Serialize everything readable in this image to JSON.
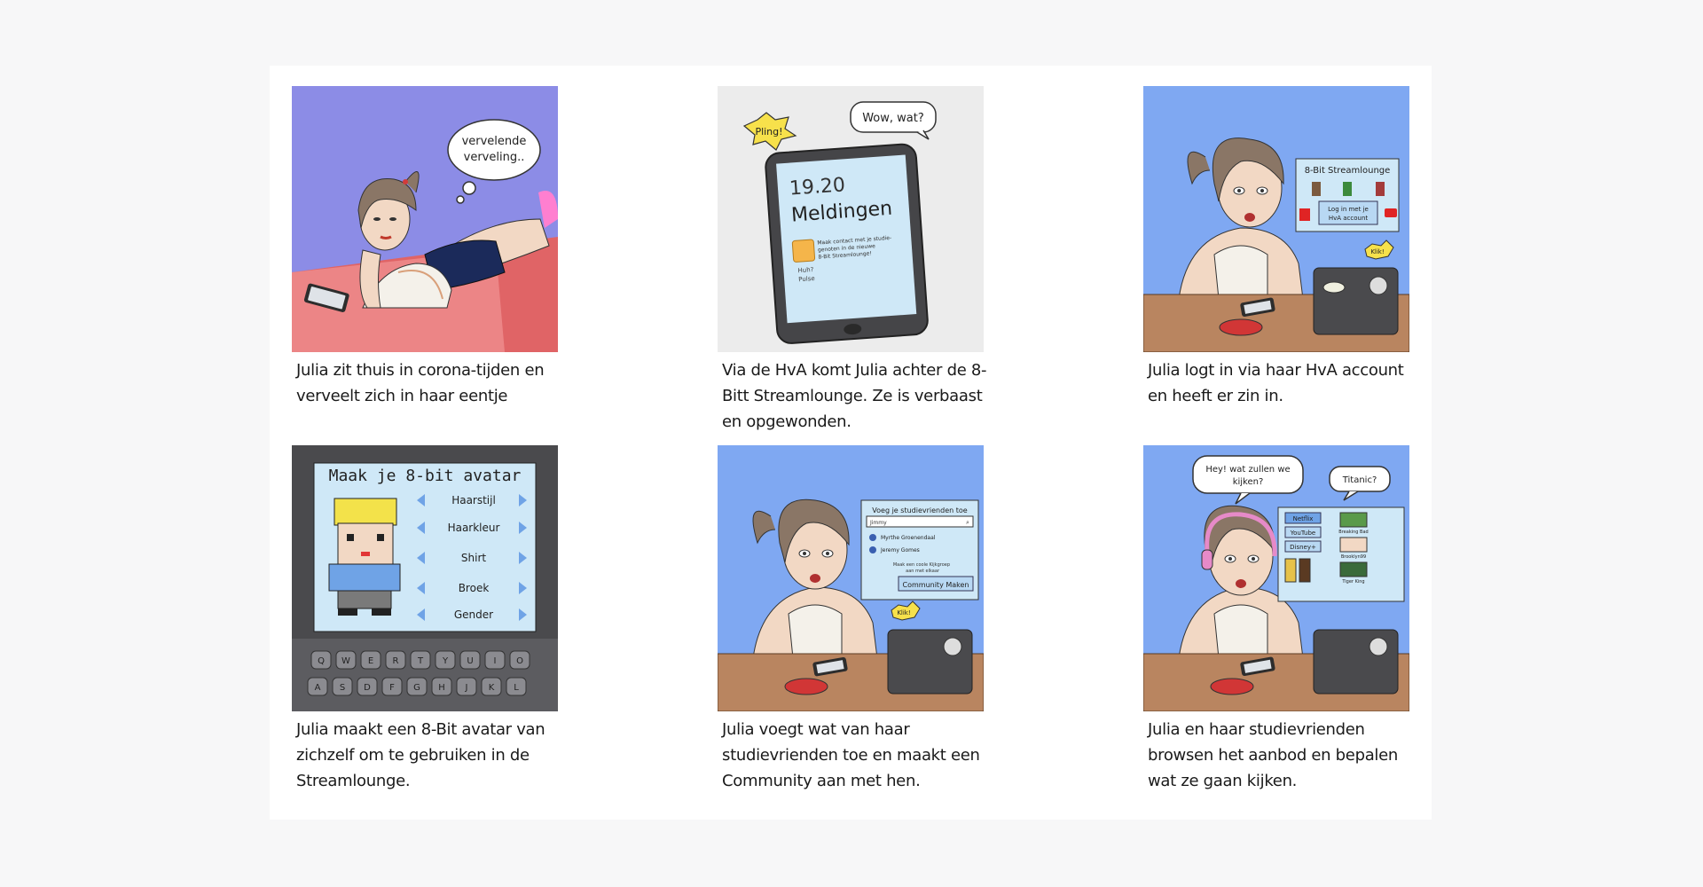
{
  "panels": [
    {
      "caption": "Julia zit thuis in corona-tijden en verveelt zich in haar eentje",
      "bubble": [
        "vervelende",
        "verveling.."
      ]
    },
    {
      "caption": "Via de HvA komt Julia achter de 8-Bitt Streamlounge. Ze is verbaast en opgewonden.",
      "burst": "Pling!",
      "bubble": "Wow, wat?",
      "phone_time": "19.20",
      "phone_title": "Meldingen",
      "notif_lines": [
        "Maak contact met je studie-",
        "genoten in de nieuwe",
        "8-Bit Streamlounge!"
      ],
      "reply_lines": [
        "Huh?",
        "Pulse"
      ]
    },
    {
      "caption": "Julia logt in via haar HvA account en heeft er zin in.",
      "screen_title": "8-Bit Streamlounge",
      "login_lines": [
        "Log in met je",
        "HvA account"
      ],
      "click": "Klik!"
    },
    {
      "caption": "Julia maakt een 8-Bit avatar van zichzelf om te gebruiken in de Streamlounge.",
      "screen_title": "Maak je 8-bit avatar",
      "options": [
        "Haarstijl",
        "Haarkleur",
        "Shirt",
        "Broek",
        "Gender"
      ],
      "keys_row1": [
        "Q",
        "W",
        "E",
        "R",
        "T",
        "Y",
        "U",
        "I",
        "O"
      ],
      "keys_row2": [
        "A",
        "S",
        "D",
        "F",
        "G",
        "H",
        "J",
        "K",
        "L"
      ]
    },
    {
      "caption": "Julia voegt wat van haar studievrienden toe en maakt een Community aan met hen.",
      "screen_title": "Voeg je studievrienden toe",
      "search": "Jimmy",
      "friends": [
        "Myrthe Groenendaal",
        "Jeremy Gomes"
      ],
      "hint_lines": [
        "Maak een coole Kijkgroep",
        "aan met elkaar"
      ],
      "button": "Community Maken",
      "click": "Klik!"
    },
    {
      "caption": "Julia en haar studievrienden browsen het aanbod en bepalen wat ze gaan kijken.",
      "bubble_left": [
        "Hey! wat zullen we",
        "kijken?"
      ],
      "bubble_right": "Titanic?",
      "services": [
        "Netflix",
        "YouTube",
        "Disney+"
      ],
      "shows": [
        "Breaking Bad",
        "Brooklyn99",
        "Tiger King"
      ]
    }
  ]
}
